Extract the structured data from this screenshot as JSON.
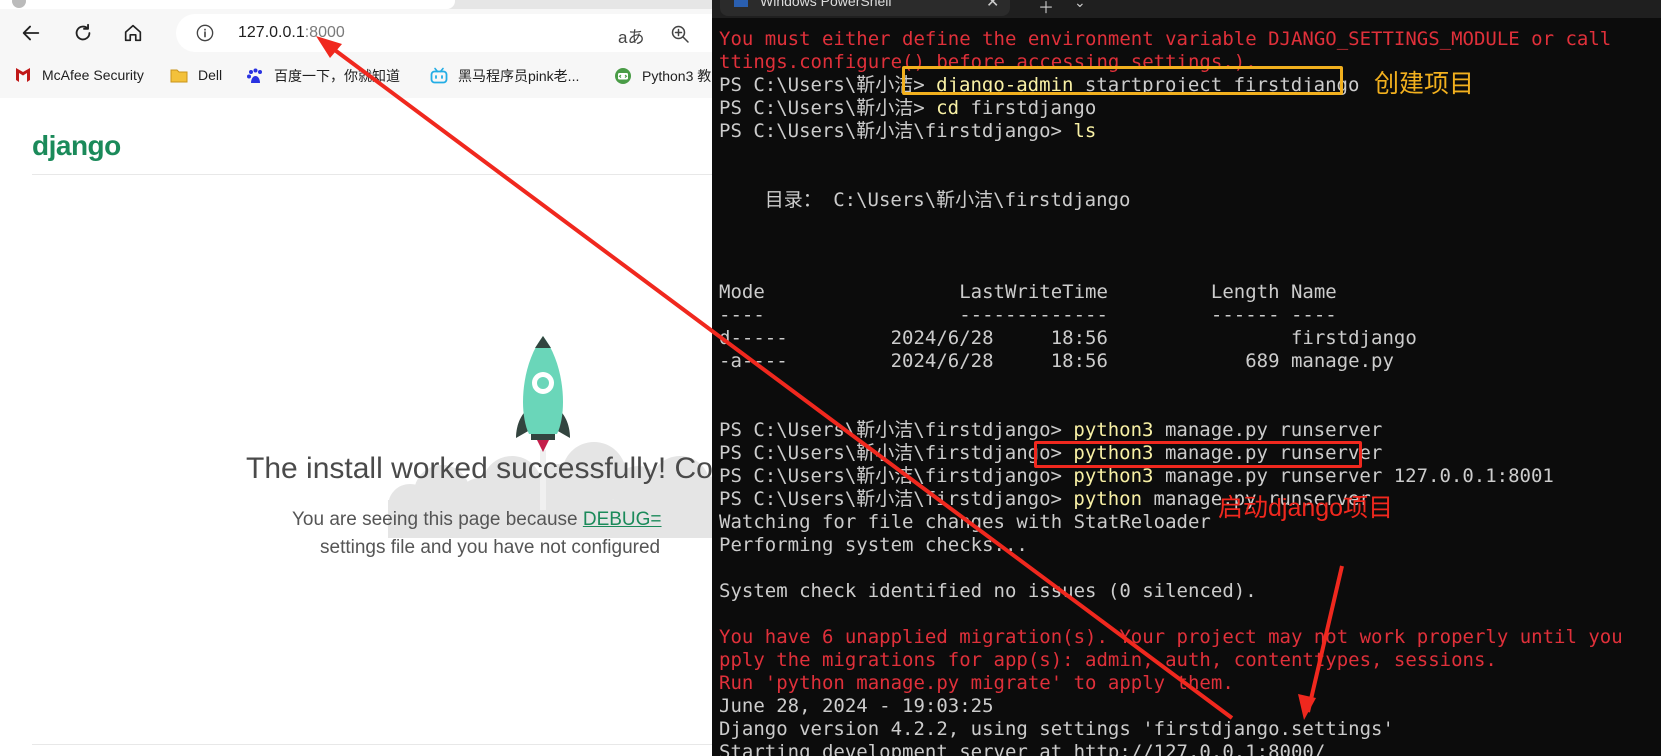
{
  "browser": {
    "address_url": "127.0.0.1",
    "address_port": ":8000",
    "read_aloud_label": "aあ",
    "bookmarks": [
      {
        "label": "McAfee Security",
        "icon": "mcafee-icon"
      },
      {
        "label": "Dell",
        "icon": "folder-icon"
      },
      {
        "label": "百度一下，你就知道",
        "icon": "baidu-icon"
      },
      {
        "label": "黑马程序员pink老...",
        "icon": "bilibili-icon"
      },
      {
        "label": "Python3 教",
        "icon": "python-icon"
      }
    ],
    "page": {
      "logo": "django",
      "title": "The install worked successfully! Co",
      "desc_prefix": "You are seeing this page because ",
      "desc_link": "DEBUG=",
      "desc_line2": "settings file and you have not configured"
    }
  },
  "terminal": {
    "tab_title": "Windows PowerShell",
    "lines": [
      {
        "t": "You must either define the environment variable DJANGO_SETTINGS_MODULE or call",
        "err": true
      },
      {
        "t": "ttings.configure() before accessing settings.).",
        "err": true
      },
      {
        "p": "PS C:\\Users\\靳小洁> ",
        "y": "django-admin",
        "c": " startproject firstdjango"
      },
      {
        "p": "PS C:\\Users\\靳小洁> ",
        "y": "cd",
        "c": " firstdjango"
      },
      {
        "p": "PS C:\\Users\\靳小洁\\firstdjango> ",
        "y": "ls",
        "c": ""
      },
      {
        "t": ""
      },
      {
        "t": ""
      },
      {
        "t": "    目录： C:\\Users\\靳小洁\\firstdjango"
      },
      {
        "t": ""
      },
      {
        "t": ""
      },
      {
        "t": ""
      },
      {
        "t": "Mode                 LastWriteTime         Length Name"
      },
      {
        "t": "----                 -------------         ------ ----"
      },
      {
        "t": "d-----         2024/6/28     18:56                firstdjango"
      },
      {
        "t": "-a----         2024/6/28     18:56            689 manage.py"
      },
      {
        "t": ""
      },
      {
        "t": ""
      },
      {
        "p": "PS C:\\Users\\靳小洁\\firstdjango> ",
        "y": "python3",
        "c": " manage.py runserver"
      },
      {
        "p": "PS C:\\Users\\靳小洁\\firstdjango> ",
        "y": "python3",
        "c": " manage.py runserver"
      },
      {
        "p": "PS C:\\Users\\靳小洁\\firstdjango> ",
        "y": "python3",
        "c": " manage.py runserver 127.0.0.1:8001"
      },
      {
        "p": "PS C:\\Users\\靳小洁\\firstdjango> ",
        "y": "python",
        "c": " manage.py runserver"
      },
      {
        "t": "Watching for file changes with StatReloader"
      },
      {
        "t": "Performing system checks..."
      },
      {
        "t": ""
      },
      {
        "t": "System check identified no issues (0 silenced)."
      },
      {
        "t": ""
      },
      {
        "t": "You have 6 unapplied migration(s). Your project may not work properly until you",
        "err": true
      },
      {
        "t": "pply the migrations for app(s): admin, auth, contenttypes, sessions.",
        "err": true
      },
      {
        "t": "Run 'python manage.py migrate' to apply them.",
        "err": true
      },
      {
        "t": "June 28, 2024 - 19:03:25"
      },
      {
        "t": "Django version 4.2.2, using settings 'firstdjango.settings'"
      },
      {
        "t": "Starting development server at http://127.0.0.1:8000/"
      }
    ]
  },
  "annotations": {
    "create_project": "创建项目",
    "start_project": "启动django项目",
    "colors": {
      "yellow_box": "#f2b01e",
      "red": "#f0281e",
      "yellow_text": "#f2b01e"
    }
  }
}
